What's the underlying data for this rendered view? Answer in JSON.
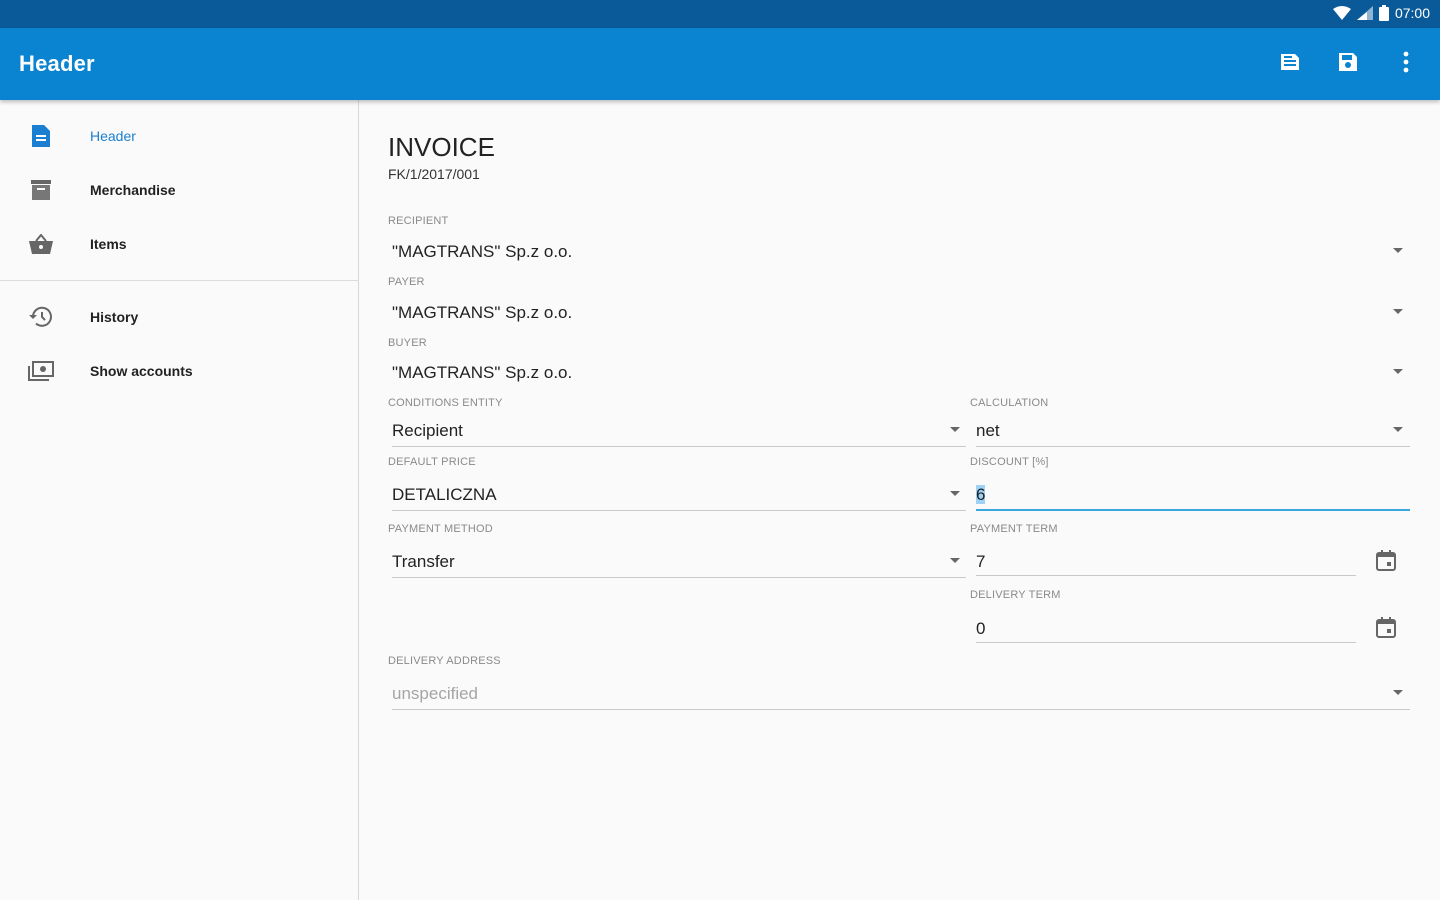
{
  "status_bar": {
    "time": "07:00",
    "icons": [
      "wifi-icon",
      "signal-icon",
      "battery-icon"
    ]
  },
  "app_bar": {
    "title": "Header",
    "actions": [
      "document-save-icon",
      "save-icon",
      "more-vert-icon"
    ]
  },
  "sidebar": {
    "items": [
      {
        "label": "Header",
        "icon": "document-icon",
        "active": true
      },
      {
        "label": "Merchandise",
        "icon": "merchandise-icon",
        "active": false
      },
      {
        "label": "Items",
        "icon": "basket-icon",
        "active": false
      }
    ],
    "secondary_items": [
      {
        "label": "History",
        "icon": "history-icon"
      },
      {
        "label": "Show accounts",
        "icon": "accounts-icon"
      }
    ]
  },
  "document": {
    "title": "INVOICE",
    "number": "FK/1/2017/001"
  },
  "form": {
    "recipient": {
      "label": "RECIPIENT",
      "value": "\"MAGTRANS\" Sp.z o.o."
    },
    "payer": {
      "label": "PAYER",
      "value": "\"MAGTRANS\" Sp.z o.o."
    },
    "buyer": {
      "label": "BUYER",
      "value": "\"MAGTRANS\" Sp.z o.o."
    },
    "conditions_entity": {
      "label": "CONDITIONS ENTITY",
      "value": "Recipient"
    },
    "calculation": {
      "label": "CALCULATION",
      "value": "net"
    },
    "default_price": {
      "label": "DEFAULT PRICE",
      "value": "DETALICZNA"
    },
    "discount": {
      "label": "DISCOUNT [%]",
      "value": "6"
    },
    "payment_method": {
      "label": "PAYMENT METHOD",
      "value": "Transfer"
    },
    "payment_term": {
      "label": "PAYMENT TERM",
      "value": "7"
    },
    "delivery_term": {
      "label": "DELIVERY TERM",
      "value": "0"
    },
    "delivery_address": {
      "label": "DELIVERY ADDRESS",
      "value": "unspecified"
    }
  },
  "colors": {
    "status_bar": "#0a5a9a",
    "app_bar": "#0a83d1",
    "accent": "#1a7fd0",
    "focus_underline": "#3aa7e0"
  }
}
